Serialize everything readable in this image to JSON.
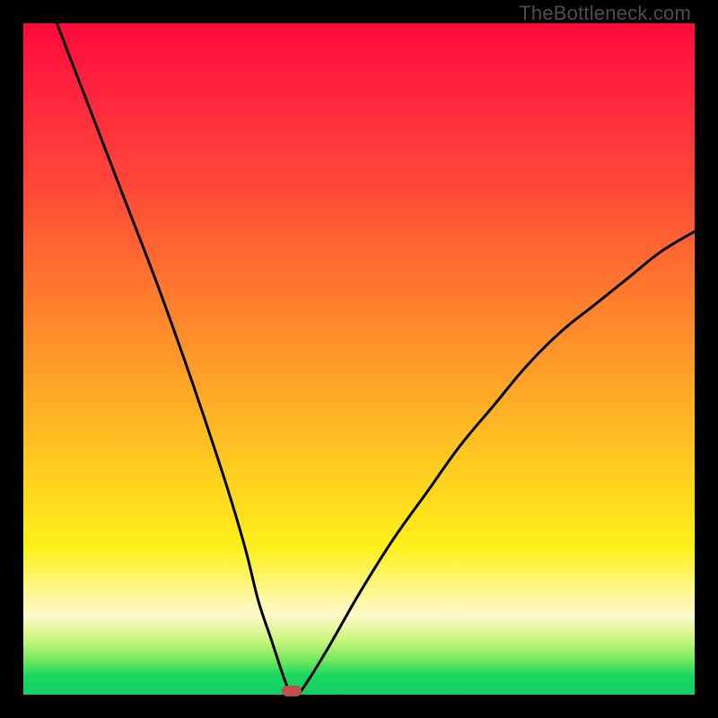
{
  "watermark": "TheBottleneck.com",
  "marker": {
    "x_pct": 39.5,
    "y_pct": 0
  },
  "colors": {
    "curve_stroke": "#000000",
    "marker_fill": "#c0504d",
    "frame_bg": "#000000"
  },
  "chart_data": {
    "type": "line",
    "title": "",
    "xlabel": "",
    "ylabel": "",
    "xlim": [
      0,
      100
    ],
    "ylim": [
      0,
      100
    ],
    "grid": false,
    "legend": false,
    "annotations": [
      "TheBottleneck.com"
    ],
    "series": [
      {
        "name": "left-branch",
        "x": [
          5,
          10,
          15,
          20,
          25,
          30,
          33,
          35,
          37,
          39,
          40,
          41
        ],
        "y": [
          100,
          87,
          74,
          61,
          47,
          32,
          22,
          14,
          8,
          2,
          0,
          0
        ]
      },
      {
        "name": "right-branch",
        "x": [
          41,
          43,
          46,
          50,
          55,
          60,
          65,
          70,
          75,
          80,
          85,
          90,
          95,
          100
        ],
        "y": [
          0,
          3,
          8,
          15,
          23,
          30,
          37,
          43,
          49,
          54,
          58,
          62,
          66,
          69
        ]
      }
    ],
    "optimum_marker": {
      "x": 40,
      "y": 0
    }
  }
}
